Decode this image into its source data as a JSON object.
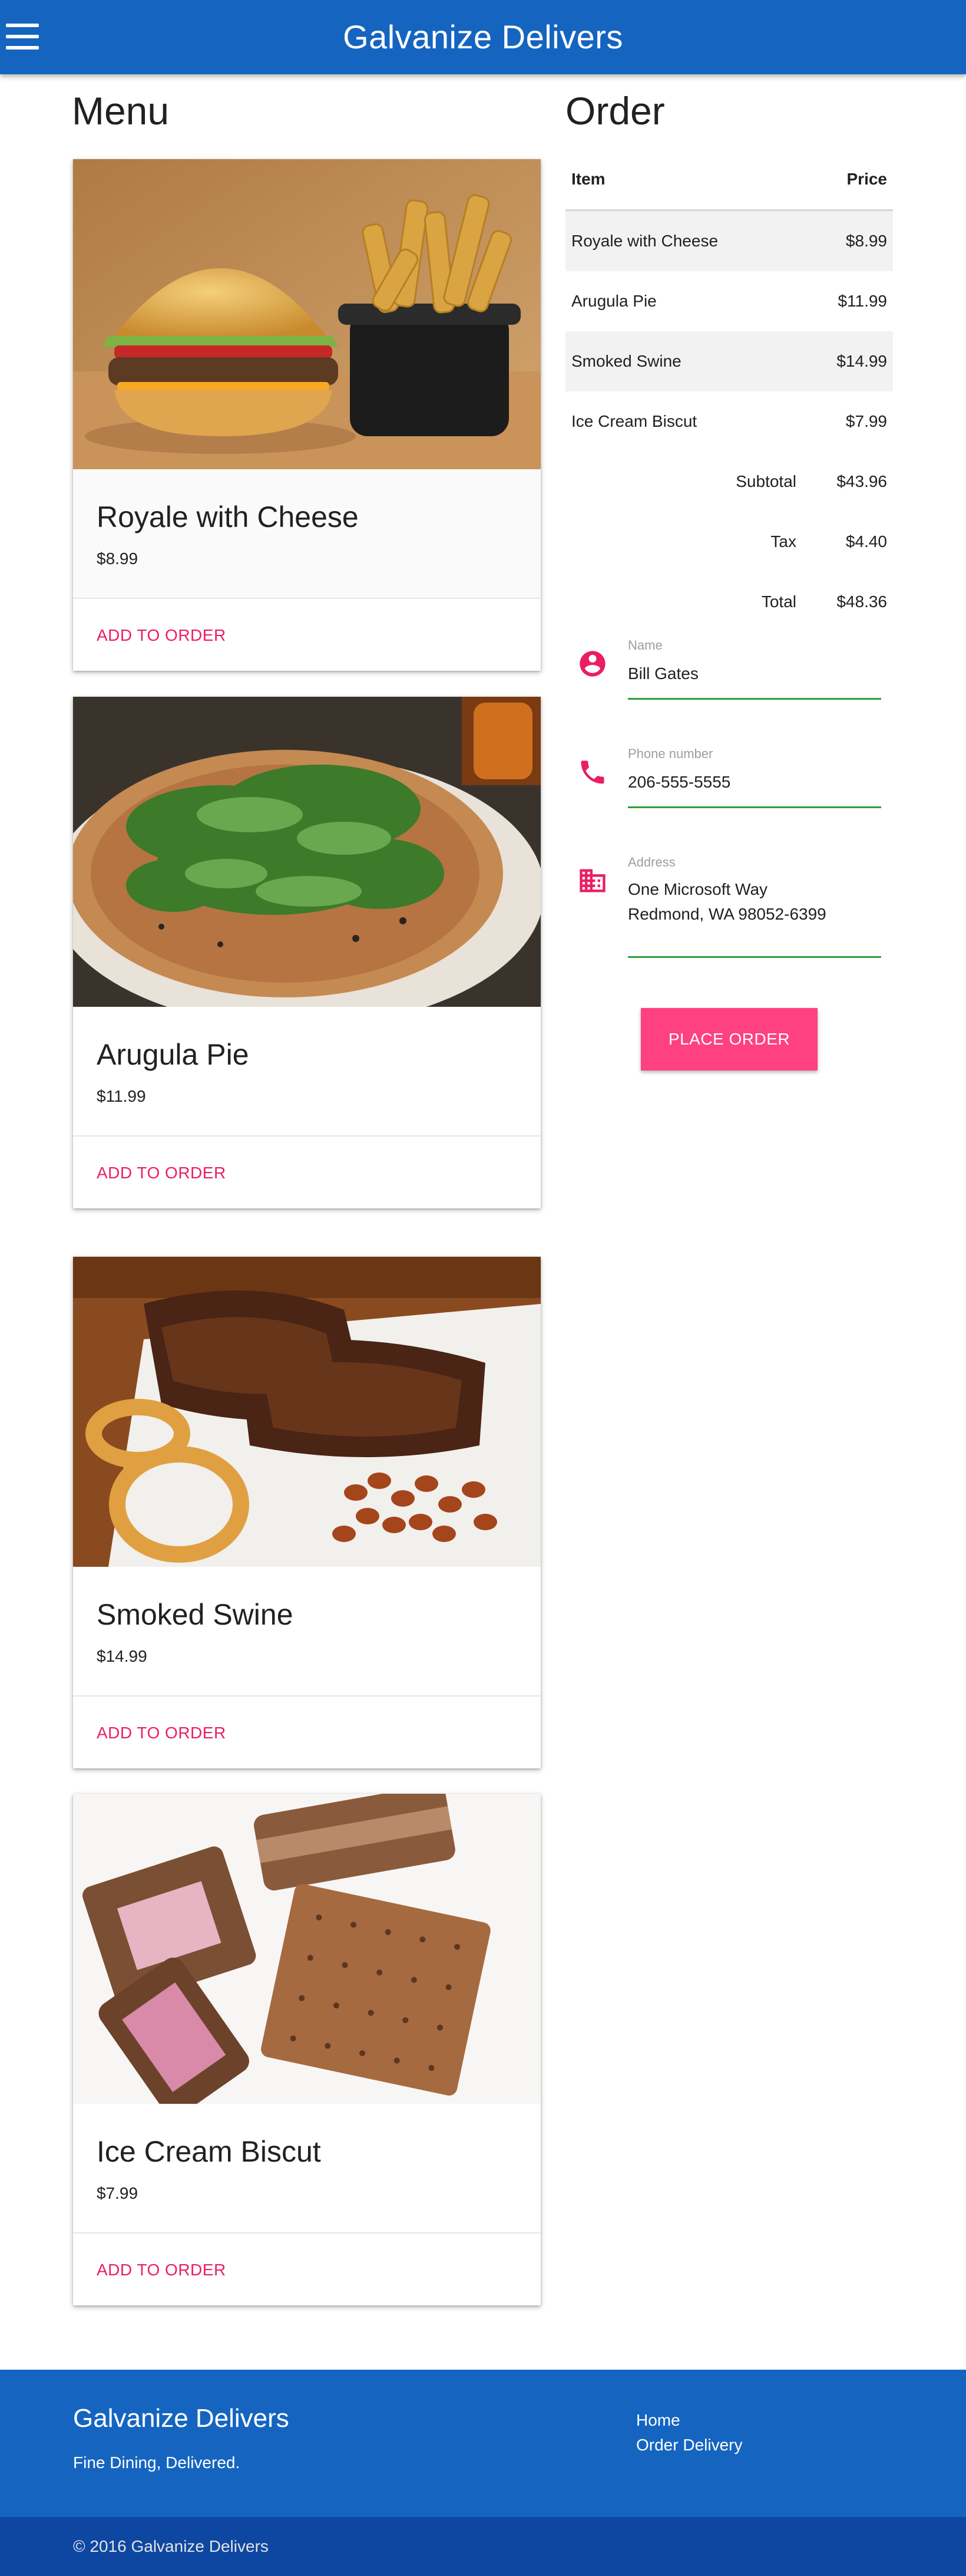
{
  "header": {
    "title": "Galvanize Delivers",
    "menu_icon": "hamburger-menu-icon"
  },
  "menu": {
    "heading": "Menu",
    "items": [
      {
        "name": "Royale with Cheese",
        "price": "$8.99",
        "action": "ADD TO ORDER"
      },
      {
        "name": "Arugula Pie",
        "price": "$11.99",
        "action": "ADD TO ORDER"
      },
      {
        "name": "Smoked Swine",
        "price": "$14.99",
        "action": "ADD TO ORDER"
      },
      {
        "name": "Ice Cream Biscut",
        "price": "$7.99",
        "action": "ADD TO ORDER"
      }
    ]
  },
  "order": {
    "heading": "Order",
    "columns": {
      "item": "Item",
      "price": "Price"
    },
    "rows": [
      {
        "item": "Royale with Cheese",
        "price": "$8.99"
      },
      {
        "item": "Arugula Pie",
        "price": "$11.99"
      },
      {
        "item": "Smoked Swine",
        "price": "$14.99"
      },
      {
        "item": "Ice Cream Biscut",
        "price": "$7.99"
      }
    ],
    "subtotal_label": "Subtotal",
    "subtotal": "$43.96",
    "tax_label": "Tax",
    "tax": "$4.40",
    "total_label": "Total",
    "total": "$48.36"
  },
  "form": {
    "name_label": "Name",
    "name_value": "Bill Gates",
    "phone_label": "Phone number",
    "phone_value": "206-555-5555",
    "address_label": "Address",
    "address_line1": "One Microsoft Way",
    "address_line2": "Redmond, WA 98052-6399",
    "submit_label": "PLACE ORDER"
  },
  "footer": {
    "title": "Galvanize Delivers",
    "tagline": "Fine Dining, Delivered.",
    "links": [
      "Home",
      "Order Delivery"
    ],
    "copyright": "© 2016 Galvanize Delivers"
  },
  "colors": {
    "primary": "#1565c0",
    "primary_dark": "#0d47a1",
    "accent": "#e91e63",
    "button": "#ff4081",
    "field_line": "#2e9d3c"
  }
}
